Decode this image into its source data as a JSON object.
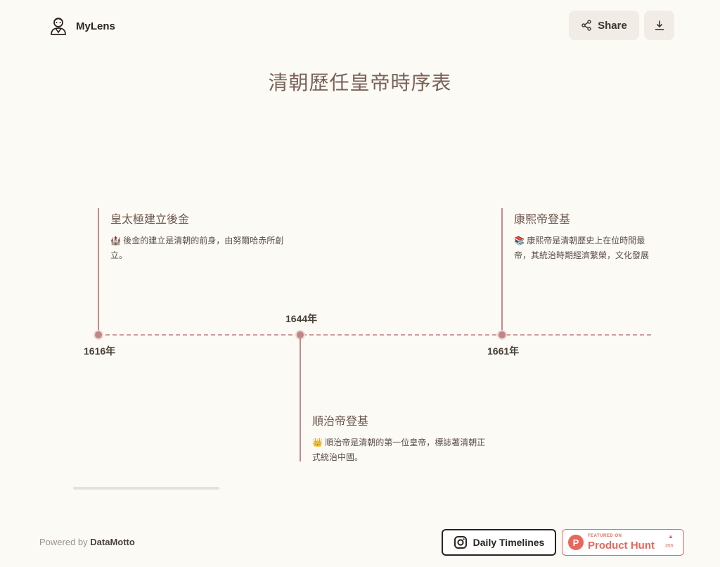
{
  "header": {
    "brand": "MyLens",
    "share_label": "Share"
  },
  "page": {
    "title": "清朝歷任皇帝時序表"
  },
  "timeline": {
    "events": [
      {
        "year": "1616年",
        "title": "皇太極建立後金",
        "emoji": "🏰",
        "desc": "後金的建立是清朝的前身，由努爾哈赤所創立。"
      },
      {
        "year": "1644年",
        "title": "順治帝登基",
        "emoji": "👑",
        "desc": "順治帝是清朝的第一位皇帝，標誌著清朝正式統治中國。"
      },
      {
        "year": "1661年",
        "title": "康熙帝登基",
        "emoji": "📚",
        "desc_line1": "康熙帝是清朝歷史上在位時間最",
        "desc_line2": "帝，其統治時期經濟繁榮，文化發展"
      }
    ]
  },
  "footer": {
    "powered_prefix": "Powered by",
    "powered_brand": "DataMotto",
    "daily_label": "Daily Timelines",
    "ph_featured": "FEATURED ON",
    "ph_name": "Product Hunt",
    "ph_count": "355"
  }
}
